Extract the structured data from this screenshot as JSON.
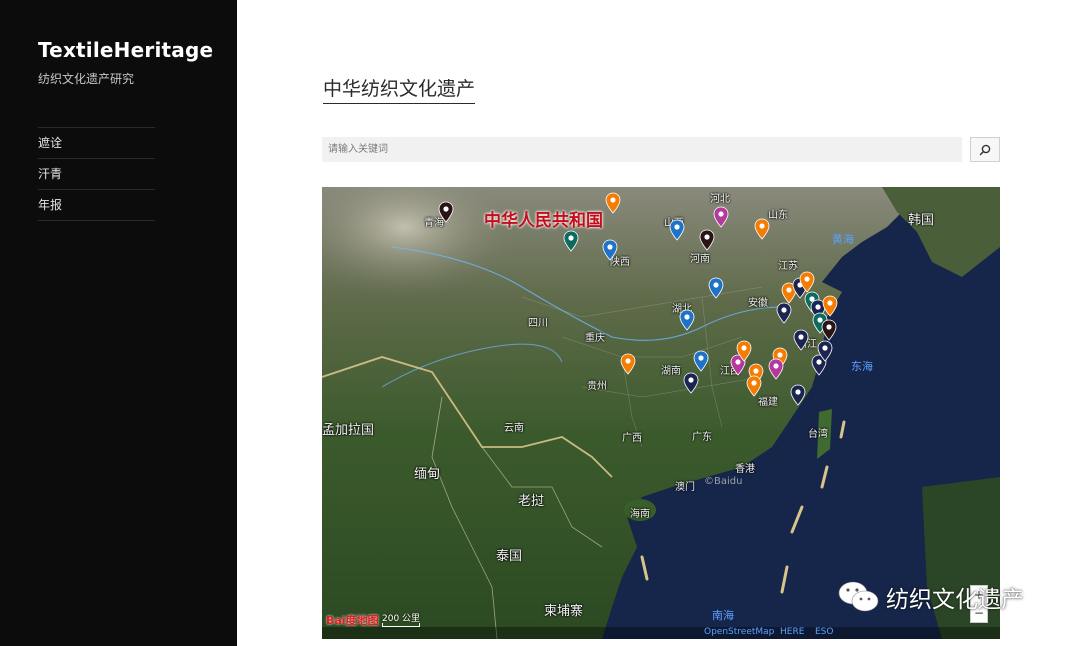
{
  "site": {
    "title": "TextileHeritage",
    "description": "纺织文化遗产研究"
  },
  "nav": {
    "items": [
      {
        "label": "遮诠"
      },
      {
        "label": "汗青"
      },
      {
        "label": "年报"
      }
    ]
  },
  "main": {
    "title": "中华纺织文化遗产",
    "search": {
      "placeholder": "请输入关键词",
      "button_icon": "search-icon"
    }
  },
  "map": {
    "country_title": "中华人民共和国",
    "labels": {
      "hebei": "河北",
      "shandong": "山东",
      "henan": "河南",
      "shaanxi": "陕西",
      "shanxi": "山西",
      "jiangsu": "江苏",
      "anhui": "安徽",
      "hubei": "湖北",
      "sichuan": "四川",
      "chongqing": "重庆",
      "guizhou": "贵州",
      "hunan": "湖南",
      "jiangxi": "江西",
      "zhejiang": "浙江",
      "fujian": "福建",
      "yunnan": "云南",
      "guangxi": "广西",
      "guangdong": "广东",
      "taiwan": "台湾",
      "hongkong": "香港",
      "macau": "澳门",
      "hainan": "海南",
      "qinghai": "青海",
      "bangladesh": "孟加拉国",
      "myanmar": "缅甸",
      "laos": "老挝",
      "thailand": "泰国",
      "cambodia": "柬埔寨",
      "korea": "韩国"
    },
    "seas": {
      "yellow_sea": "黄海",
      "east_sea": "东海",
      "south_sea": "南海"
    },
    "copyright": "©Baidu",
    "logo": "Bai度地图",
    "scale_label": "200 公里",
    "attribution": [
      "OpenStreetMap",
      "HERE",
      "ESO"
    ],
    "zoom_in": "+",
    "zoom_out": "−",
    "pin_colors": {
      "orange": "#f57c00",
      "blue": "#1e73c9",
      "navy": "#1c2452",
      "teal": "#0c6b5e",
      "magenta": "#b5389c",
      "dark": "#2a1416"
    }
  },
  "watermark": {
    "text": "纺织文化遗产",
    "icon": "wechat-icon"
  }
}
